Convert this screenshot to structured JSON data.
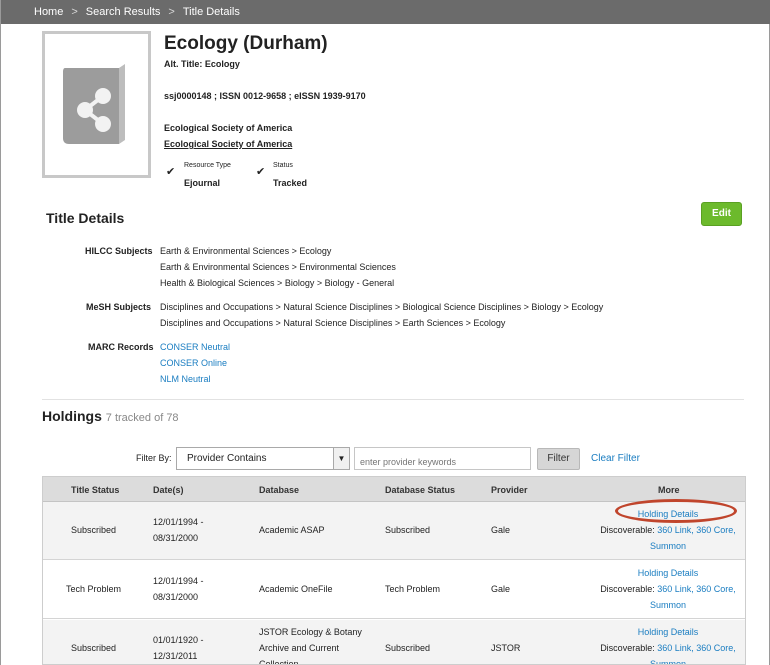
{
  "breadcrumb": {
    "home": "Home",
    "sep": ">",
    "search_results": "Search Results",
    "current": "Title Details"
  },
  "title": {
    "name": "Ecology (Durham)",
    "alt_title": "Alt. Title: Ecology",
    "identifiers": "ssj0000148 ; ISSN 0012-9658 ; eISSN 1939-9170",
    "publisher": "Ecological Society of America",
    "publisher_link": "Ecological Society of America",
    "resource_type_label": "Resource Type",
    "resource_type_value": "Ejournal",
    "status_label": "Status",
    "status_value": "Tracked",
    "check_glyph": "✔"
  },
  "title_details": {
    "heading": "Title Details",
    "edit_label": "Edit",
    "hilcc_label": "HILCC Subjects",
    "hilcc": [
      "Earth & Environmental Sciences > Ecology",
      "Earth & Environmental Sciences > Environmental Sciences",
      "Health & Biological Sciences > Biology > Biology - General"
    ],
    "mesh_label": "MeSH Subjects",
    "mesh": [
      "Disciplines and Occupations > Natural Science Disciplines > Biological Science Disciplines > Biology > Ecology",
      "Disciplines and Occupations > Natural Science Disciplines > Earth Sciences > Ecology"
    ],
    "marc_label": "MARC Records",
    "marc": [
      "CONSER Neutral",
      "CONSER Online",
      "NLM Neutral"
    ]
  },
  "holdings": {
    "heading": "Holdings",
    "count": "7 tracked of 78",
    "filter_by_label": "Filter By:",
    "filter_select": "Provider Contains",
    "select_arrow": "▼",
    "keyword_placeholder": "enter provider keywords",
    "filter_button": "Filter",
    "clear_filter": "Clear Filter",
    "columns": [
      "Title Status",
      "Date(s)",
      "Database",
      "Database Status",
      "Provider",
      "More"
    ],
    "rows": [
      {
        "title_status": "Subscribed",
        "date_from": "12/01/1994 -",
        "date_to": "08/31/2000",
        "database": [
          "Academic ASAP"
        ],
        "db_status": "Subscribed",
        "provider": "Gale",
        "details": "Holding Details",
        "discoverable_label": "Discoverable:",
        "discoverable_links": "360 Link, 360 Core,",
        "discoverable_links2": "Summon"
      },
      {
        "title_status": "Tech Problem",
        "date_from": "12/01/1994 -",
        "date_to": "08/31/2000",
        "database": [
          "Academic OneFile"
        ],
        "db_status": "Tech Problem",
        "provider": "Gale",
        "details": "Holding Details",
        "discoverable_label": "Discoverable:",
        "discoverable_links": "360 Link, 360 Core,",
        "discoverable_links2": "Summon"
      },
      {
        "title_status": "Subscribed",
        "date_from": "01/01/1920 -",
        "date_to": "12/31/2011",
        "database": [
          "JSTOR Ecology & Botany",
          "Archive and Current",
          "Collection"
        ],
        "db_status": "Subscribed",
        "provider": "JSTOR",
        "details": "Holding Details",
        "discoverable_label": "Discoverable:",
        "discoverable_links": "360 Link, 360 Core,",
        "discoverable_links2": "Summon"
      }
    ]
  },
  "colors": {
    "link": "#1a7dc1",
    "edit_button": "#6cba2c",
    "highlight_oval": "#c0452c",
    "topbar": "#6b6b6b"
  }
}
